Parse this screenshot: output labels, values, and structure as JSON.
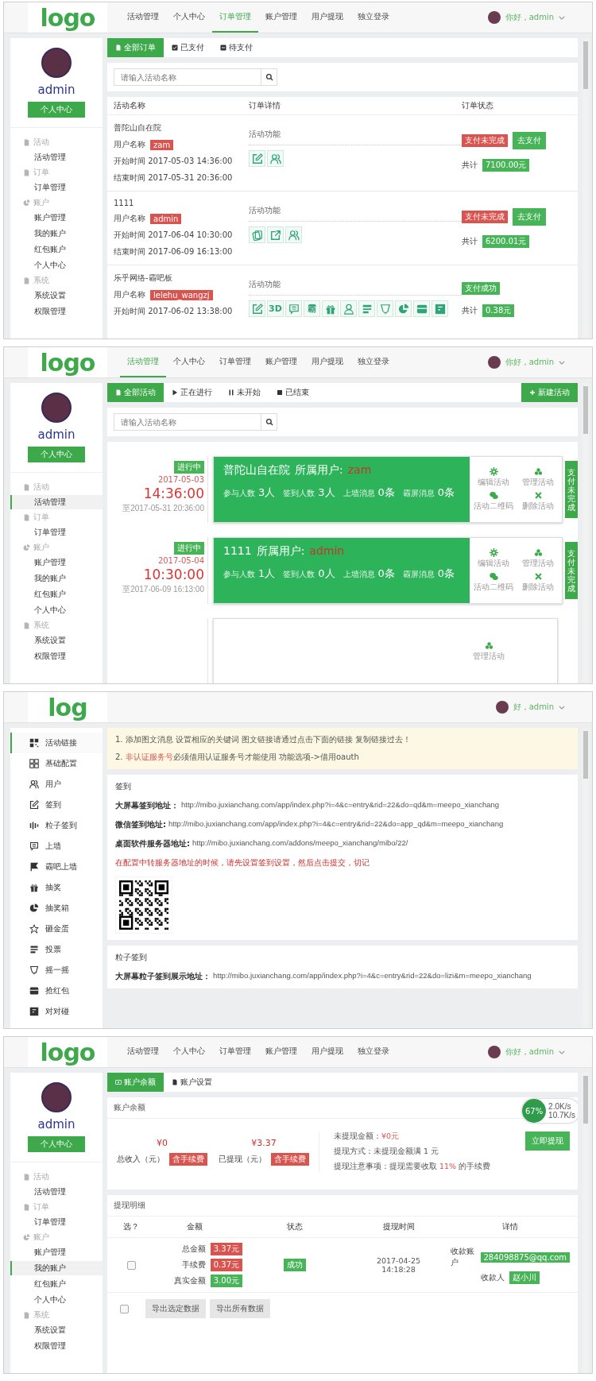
{
  "screens": [
    {
      "kind": "orders",
      "header": {
        "logo": "logo",
        "nav": [
          {
            "label": "活动管理",
            "selected": false
          },
          {
            "label": "个人中心",
            "selected": false
          },
          {
            "label": "订单管理",
            "selected": true
          },
          {
            "label": "账户管理",
            "selected": false
          },
          {
            "label": "用户提现",
            "selected": false
          },
          {
            "label": "独立登录",
            "selected": false
          }
        ],
        "greeting": "你好，admin"
      },
      "sidebar": {
        "kind": "profile",
        "name": "admin",
        "button": "个人中心",
        "groups": [
          {
            "label": "活动",
            "children": [
              {
                "label": "活动管理",
                "selected": false
              }
            ]
          },
          {
            "label": "订单",
            "children": [
              {
                "label": "订单管理",
                "selected": false
              }
            ]
          },
          {
            "label": "账户",
            "children": [
              {
                "label": "账户管理",
                "selected": false
              },
              {
                "label": "我的账户",
                "selected": false
              },
              {
                "label": "红包账户",
                "selected": false
              },
              {
                "label": "个人中心",
                "selected": false
              }
            ]
          },
          {
            "label": "系统",
            "children": [
              {
                "label": "系统设置",
                "selected": false
              },
              {
                "label": "权限管理",
                "selected": false
              }
            ]
          }
        ]
      },
      "tabs": [
        {
          "label": "全部订单",
          "selected": true
        },
        {
          "label": "已支付",
          "selected": false
        },
        {
          "label": "待支付",
          "selected": false
        }
      ],
      "search": {
        "placeholder": "请输入活动名称"
      },
      "table": {
        "columns": [
          "活动名称",
          "订单详情",
          "订单状态"
        ],
        "rows": [
          {
            "name": "普陀山自在院",
            "user_label": "用户名称",
            "user": "zam",
            "start": "开始时间 2017-05-03 14:36:00",
            "end": "结束时间 2017-05-31 20:36:00",
            "features_label": "活动功能",
            "features": [
              {
                "kind": "edit"
              },
              {
                "kind": "users"
              }
            ],
            "status": {
              "label": "支付未完成",
              "kind": "unpaid"
            },
            "pay_button": "去支付",
            "total_label": "共计",
            "total": "7100.00元"
          },
          {
            "name": "1111",
            "user_label": "用户名称",
            "user": "admin",
            "start": "开始时间 2017-06-04 10:30:00",
            "end": "结束时间 2017-06-09 16:13:00",
            "features_label": "活动功能",
            "features": [
              {
                "kind": "cards"
              },
              {
                "kind": "share"
              },
              {
                "kind": "users"
              }
            ],
            "status": {
              "label": "支付未完成",
              "kind": "unpaid"
            },
            "pay_button": "去支付",
            "total_label": "共计",
            "total": "6200.01元"
          },
          {
            "name": "乐乎网络-霸吧板",
            "user_label": "用户名称",
            "user": "lelehu_wangzj",
            "start": "开始时间 2017-06-02 13:38:00",
            "features_label": "活动功能",
            "features": [
              {
                "kind": "edit"
              },
              {
                "kind": "glyph",
                "glyph": "3D"
              },
              {
                "kind": "chat"
              },
              {
                "kind": "glyph",
                "glyph": "霸"
              },
              {
                "kind": "gift"
              },
              {
                "kind": "person"
              },
              {
                "kind": "list"
              },
              {
                "kind": "cup"
              },
              {
                "kind": "pie"
              },
              {
                "kind": "box"
              },
              {
                "kind": "calendar"
              }
            ],
            "status": {
              "label": "支付成功",
              "kind": "paid"
            },
            "total_label": "共计",
            "total": "0.38元"
          }
        ]
      }
    },
    {
      "kind": "activities",
      "header": {
        "logo": "logo",
        "nav": [
          {
            "label": "活动管理",
            "selected": true
          },
          {
            "label": "个人中心",
            "selected": false
          },
          {
            "label": "订单管理",
            "selected": false
          },
          {
            "label": "账户管理",
            "selected": false
          },
          {
            "label": "用户提现",
            "selected": false
          },
          {
            "label": "独立登录",
            "selected": false
          }
        ],
        "greeting": "你好，admin"
      },
      "sidebar": {
        "kind": "profile",
        "name": "admin",
        "button": "个人中心",
        "groups": [
          {
            "label": "活动",
            "children": [
              {
                "label": "活动管理",
                "selected": true
              }
            ]
          },
          {
            "label": "订单",
            "children": [
              {
                "label": "订单管理",
                "selected": false
              }
            ]
          },
          {
            "label": "账户",
            "children": [
              {
                "label": "账户管理",
                "selected": false
              },
              {
                "label": "我的账户",
                "selected": false
              },
              {
                "label": "红包账户",
                "selected": false
              },
              {
                "label": "个人中心",
                "selected": false
              }
            ]
          },
          {
            "label": "系统",
            "children": [
              {
                "label": "系统设置",
                "selected": false
              },
              {
                "label": "权限管理",
                "selected": false
              }
            ]
          }
        ]
      },
      "tabs": [
        {
          "label": "全部活动",
          "selected": true
        },
        {
          "label": "正在进行",
          "selected": false
        },
        {
          "label": "未开始",
          "selected": false
        },
        {
          "label": "已结束",
          "selected": false
        }
      ],
      "new_button": "新建活动",
      "search": {
        "placeholder": "请输入活动名称"
      },
      "activities": [
        {
          "status": "进行中",
          "date": "2017-05-03",
          "time": "14:36:00",
          "until": "至2017-05-31 20:36:00",
          "title": "普陀山自在院",
          "owner_label": "所属用户:",
          "owner": "zam",
          "stats": [
            {
              "label": "参与人数",
              "value": "3人"
            },
            {
              "label": "签到人数",
              "value": "3人"
            },
            {
              "label": "上墙消息",
              "value": "0条"
            },
            {
              "label": "霸屏消息",
              "value": "0条"
            }
          ],
          "actions": [
            {
              "label": "编辑活动",
              "kind": "gear"
            },
            {
              "label": "管理活动",
              "kind": "coins"
            },
            {
              "label": "活动二维码",
              "kind": "wechat"
            },
            {
              "label": "删除活动",
              "kind": "cross"
            }
          ],
          "pay_state": "支付未完成"
        },
        {
          "status": "进行中",
          "date": "2017-05-04",
          "time": "10:30:00",
          "until": "至2017-06-09 16:13:00",
          "title": "1111",
          "owner_label": "所属用户:",
          "owner": "admin",
          "stats": [
            {
              "label": "参与人数",
              "value": "1人"
            },
            {
              "label": "签到人数",
              "value": "0人"
            },
            {
              "label": "上墙消息",
              "value": "0条"
            },
            {
              "label": "霸屏消息",
              "value": "0条"
            }
          ],
          "actions": [
            {
              "label": "编辑活动",
              "kind": "gear"
            },
            {
              "label": "管理活动",
              "kind": "coins"
            },
            {
              "label": "活动二维码",
              "kind": "wechat"
            },
            {
              "label": "删除活动",
              "kind": "cross"
            }
          ],
          "pay_state": "支付未完成"
        },
        {
          "actions": [
            {
              "label": "管理活动",
              "kind": "coins"
            }
          ]
        }
      ]
    },
    {
      "kind": "links",
      "header": {
        "logo": "log",
        "greeting": "好，admin"
      },
      "sidebar": {
        "kind": "menu",
        "items": [
          {
            "label": "活动链接",
            "kind": "qr",
            "selected": true
          },
          {
            "label": "基础配置",
            "kind": "grid",
            "selected": false
          },
          {
            "label": "用户",
            "kind": "users",
            "selected": false
          },
          {
            "label": "签到",
            "kind": "edit",
            "selected": false
          },
          {
            "label": "粒子签到",
            "kind": "bars",
            "selected": false
          },
          {
            "label": "上墙",
            "kind": "chat",
            "selected": false
          },
          {
            "label": "霸吧上墙",
            "kind": "flag",
            "selected": false
          },
          {
            "label": "抽奖",
            "kind": "gift",
            "selected": false
          },
          {
            "label": "抽奖箱",
            "kind": "pie",
            "selected": false
          },
          {
            "label": "砸金蛋",
            "kind": "star",
            "selected": false
          },
          {
            "label": "投票",
            "kind": "list",
            "selected": false
          },
          {
            "label": "摇一摇",
            "kind": "cup",
            "selected": false
          },
          {
            "label": "抢红包",
            "kind": "box",
            "selected": false
          },
          {
            "label": "对对碰",
            "kind": "calendar",
            "selected": false
          }
        ]
      },
      "notice": [
        {
          "number": "1.",
          "text": "添加图文消息 设置相应的关键词 图文链接请通过点击下面的链接 复制链接过去！"
        },
        {
          "number": "2.",
          "warn": "非认证服务号",
          "text": "必须借用认证服务号才能使用 功能选项->借用oauth"
        }
      ],
      "sections": [
        {
          "title": "签到",
          "links": [
            {
              "label": "大屏幕签到地址：",
              "url": "http://mibo.juxianchang.com/app/index.php?i=4&c=entry&rid=22&do=qd&m=meepo_xianchang"
            },
            {
              "label": "微信签到地址:",
              "url": "http://mibo.juxianchang.com/app/index.php?i=4&c=entry&rid=22&do=app_qd&m=meepo_xianchang"
            },
            {
              "label": "桌面软件服务器地址:",
              "url": "http://mibo.juxianchang.com/addons/meepo_xianchang/mibo/22/"
            }
          ],
          "note": "在配置中转服务器地址的时候，请先设置签到设置，然后点击提交，切记",
          "qr": true
        },
        {
          "title": "粒子签到",
          "links": [
            {
              "label": "大屏幕粒子签到展示地址：",
              "url": "http://mibo.juxianchang.com/app/index.php?i=4&c=entry&rid=22&do=lizi&m=meepo_xianchang"
            }
          ]
        }
      ]
    },
    {
      "kind": "account",
      "header": {
        "logo": "logo",
        "nav": [
          {
            "label": "活动管理",
            "selected": false
          },
          {
            "label": "个人中心",
            "selected": false
          },
          {
            "label": "订单管理",
            "selected": false
          },
          {
            "label": "账户管理",
            "selected": false
          },
          {
            "label": "用户提现",
            "selected": false
          },
          {
            "label": "独立登录",
            "selected": false
          }
        ],
        "greeting": "你好，admin"
      },
      "sidebar": {
        "kind": "profile",
        "name": "admin",
        "button": "个人中心",
        "groups": [
          {
            "label": "活动",
            "children": [
              {
                "label": "活动管理",
                "selected": false
              }
            ]
          },
          {
            "label": "订单",
            "children": [
              {
                "label": "订单管理",
                "selected": false
              }
            ]
          },
          {
            "label": "账户",
            "children": [
              {
                "label": "账户管理",
                "selected": false
              },
              {
                "label": "我的账户",
                "selected": true
              },
              {
                "label": "红包账户",
                "selected": false
              },
              {
                "label": "个人中心",
                "selected": false
              }
            ]
          },
          {
            "label": "系统",
            "children": [
              {
                "label": "系统设置",
                "selected": false
              },
              {
                "label": "权限管理",
                "selected": false
              }
            ]
          }
        ]
      },
      "tabs": [
        {
          "label": "账户余额",
          "selected": true
        },
        {
          "label": "账户设置",
          "selected": false
        }
      ],
      "balance": {
        "title": "账户余额",
        "figures": [
          {
            "amount": "¥0",
            "label": "总收入（元）",
            "badge": "含手续费"
          },
          {
            "amount": "¥3.37",
            "label": "已提现（元）",
            "badge": "含手续费"
          }
        ],
        "info": [
          {
            "text": "未提现金额：",
            "highlight": "¥0元"
          },
          {
            "text": "提现方式：未提现金额满 1 元"
          },
          {
            "text": "提现注意事项：提现需要收取 ",
            "highlight": "11%",
            "tail": " 的手续费"
          }
        ],
        "button": "立即提现"
      },
      "speed_widget": {
        "percent": "67%",
        "up": "2.0K/s",
        "down": "10.7K/s"
      },
      "withdrawals": {
        "title": "提现明细",
        "columns": [
          "选？",
          "金额",
          "状态",
          "提现时间",
          "详情"
        ],
        "rows": [
          {
            "checked": false,
            "amounts": [
              {
                "label": "总金额",
                "value": "3.37元",
                "kind": "debit"
              },
              {
                "label": "手续费",
                "value": "0.37元",
                "kind": "debit"
              },
              {
                "label": "真实金额",
                "value": "3.00元",
                "kind": "net"
              }
            ],
            "status": "成功",
            "time": "2017-04-25 14:18:28",
            "details": [
              {
                "label": "收款账户",
                "value": "284098875@qq.com"
              },
              {
                "label": "收款人",
                "value": "赵小川"
              }
            ]
          }
        ],
        "footer": {
          "checked": false,
          "buttons": [
            "导出选定数据",
            "导出所有数据"
          ]
        }
      }
    }
  ]
}
